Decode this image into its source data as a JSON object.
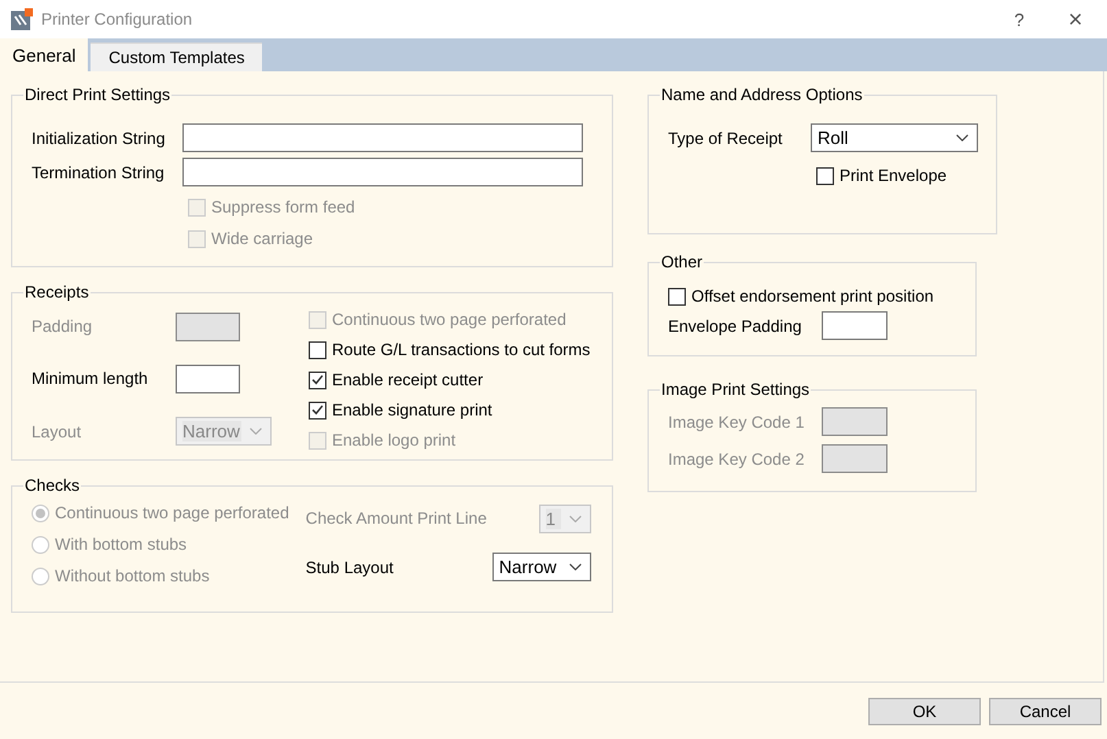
{
  "window": {
    "title": "Printer Configuration",
    "help": "?",
    "close": "×"
  },
  "tabs": [
    {
      "label": "General",
      "selected": true
    },
    {
      "label": "Custom Templates",
      "selected": false
    }
  ],
  "direct_print": {
    "title": "Direct Print Settings",
    "fields": [
      {
        "label": "Initialization String",
        "disabled": false
      },
      {
        "label": "Termination String",
        "disabled": false
      }
    ],
    "checkboxes": [
      {
        "label": "Suppress form feed",
        "checked": false,
        "disabled": true
      },
      {
        "label": "Wide carriage",
        "checked": false,
        "disabled": true
      }
    ]
  },
  "receipts": {
    "title": "Receipts",
    "fields": [
      {
        "kind": "text",
        "label": "Padding",
        "disabled": true
      },
      {
        "kind": "text",
        "label": "Minimum length",
        "disabled": false
      },
      {
        "kind": "dropdown",
        "label": "Layout",
        "value": "Narrow",
        "disabled": true
      }
    ],
    "checkboxes": [
      {
        "label": "Continuous two page perforated",
        "checked": false,
        "disabled": true
      },
      {
        "label": "Route G/L transactions to cut forms",
        "checked": false,
        "disabled": false
      },
      {
        "label": "Enable receipt cutter",
        "checked": true,
        "disabled": false
      },
      {
        "label": "Enable signature print",
        "checked": true,
        "disabled": false
      },
      {
        "label": "Enable logo print",
        "checked": false,
        "disabled": true
      }
    ]
  },
  "checks": {
    "title": "Checks",
    "radios": [
      {
        "label": "Continuous two page perforated",
        "selected": true,
        "disabled": true
      },
      {
        "label": "With bottom stubs",
        "selected": false,
        "disabled": true
      },
      {
        "label": "Without bottom stubs",
        "selected": false,
        "disabled": true
      }
    ],
    "fields": [
      {
        "kind": "dropdown",
        "label": "Check Amount Print Line",
        "value": "1",
        "disabled": true
      },
      {
        "kind": "dropdown",
        "label": "Stub Layout",
        "value": "Narrow",
        "disabled": false
      }
    ]
  },
  "name_address": {
    "title": "Name and Address Options",
    "fields": [
      {
        "kind": "dropdown",
        "label": "Type of Receipt",
        "value": "Roll",
        "disabled": false
      }
    ],
    "checkboxes": [
      {
        "label": "Print Envelope",
        "checked": false,
        "disabled": false
      }
    ]
  },
  "other": {
    "title": "Other",
    "checkboxes": [
      {
        "label": "Offset endorsement print position",
        "checked": false,
        "disabled": false
      }
    ],
    "fields": [
      {
        "label": "Envelope Padding",
        "disabled": false
      }
    ]
  },
  "image_print": {
    "title": "Image Print Settings",
    "fields": [
      {
        "label": "Image Key Code 1",
        "disabled": true
      },
      {
        "label": "Image Key Code 2",
        "disabled": true
      }
    ]
  },
  "buttons": [
    "OK",
    "Cancel"
  ]
}
